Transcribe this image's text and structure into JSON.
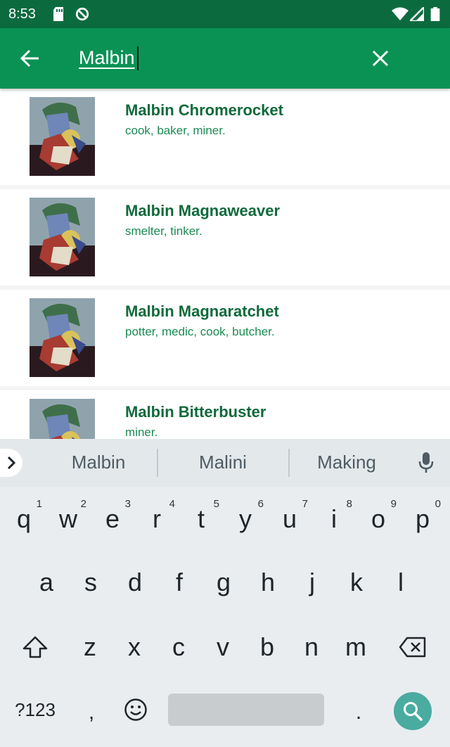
{
  "status_bar": {
    "time": "8:53",
    "icons": [
      "sd-card-icon",
      "do-not-disturb-icon",
      "wifi-icon",
      "signal-icon",
      "battery-icon"
    ]
  },
  "search_bar": {
    "query": "Malbin",
    "background": "#0a9255",
    "back_icon": "arrow-left-icon",
    "clear_icon": "close-icon"
  },
  "results": [
    {
      "name": "Malbin Chromerocket",
      "jobs": "cook, baker, miner."
    },
    {
      "name": "Malbin Magnaweaver",
      "jobs": "smelter, tinker."
    },
    {
      "name": "Malbin Magnaratchet",
      "jobs": "potter, medic, cook, butcher."
    },
    {
      "name": "Malbin Bitterbuster",
      "jobs": "miner."
    }
  ],
  "keyboard": {
    "suggestions": [
      "Malbin",
      "Malini",
      "Making"
    ],
    "row1": [
      {
        "k": "q",
        "h": "1"
      },
      {
        "k": "w",
        "h": "2"
      },
      {
        "k": "e",
        "h": "3"
      },
      {
        "k": "r",
        "h": "4"
      },
      {
        "k": "t",
        "h": "5"
      },
      {
        "k": "y",
        "h": "6"
      },
      {
        "k": "u",
        "h": "7"
      },
      {
        "k": "i",
        "h": "8"
      },
      {
        "k": "o",
        "h": "9"
      },
      {
        "k": "p",
        "h": "0"
      }
    ],
    "row2": [
      "a",
      "s",
      "d",
      "f",
      "g",
      "h",
      "j",
      "k",
      "l"
    ],
    "row3": [
      "z",
      "x",
      "c",
      "v",
      "b",
      "n",
      "m"
    ],
    "symbols_label": "?123",
    "comma": ",",
    "period": ".",
    "accent_color": "#4aaba0"
  }
}
